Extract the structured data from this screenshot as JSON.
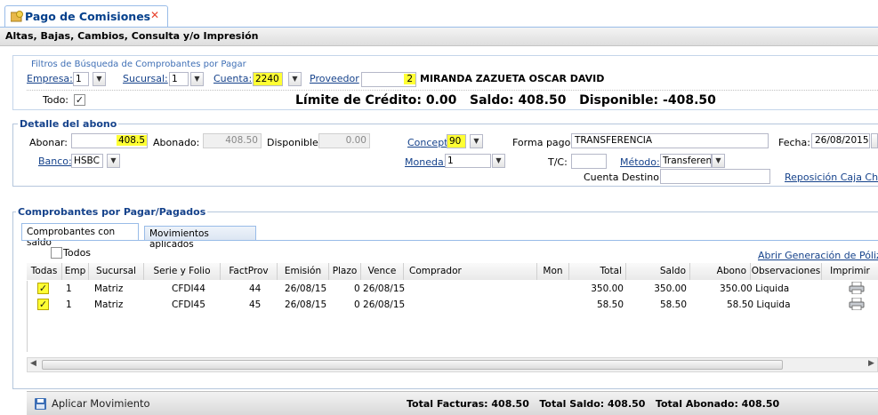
{
  "tab": {
    "label": "Pago de Comisiones",
    "close": "✕"
  },
  "title_bar": "Altas, Bajas, Cambios, Consulta y/o Impresión",
  "filters": {
    "title": "Filtros de Búsqueda de Comprobantes por Pagar",
    "empresa_label": "Empresa:",
    "empresa_value": "1",
    "sucursal_label": "Sucursal:",
    "sucursal_value": "1",
    "cuenta_label": "Cuenta:",
    "cuenta_value": "2240",
    "proveedor_label": "Proveedor",
    "proveedor_id": "2",
    "proveedor_name": "MIRANDA ZAZUETA OSCAR DAVID",
    "todo_label": "Todo:",
    "summary": "Límite de Crédito: 0.00   Saldo: 408.50   Disponible: -408.50"
  },
  "detalle": {
    "legend": "Detalle del abono",
    "abonar_label": "Abonar:",
    "abonar_value": "408.5",
    "abonado_label": "Abonado:",
    "abonado_value": "408.50",
    "disponible_label": "Disponible",
    "disponible_value": "0.00",
    "concepto_label": "Concepto:",
    "concepto_value": "90",
    "forma_pago_label": "Forma pago:",
    "forma_pago_value": "TRANSFERENCIA",
    "fecha_label": "Fecha:",
    "fecha_value": "26/08/2015",
    "banco_label": "Banco:",
    "banco_value": "HSBC",
    "moneda_label": "Moneda:",
    "moneda_value": "1",
    "tc_label": "T/C:",
    "tc_value": "",
    "metodo_label": "Método:",
    "metodo_value": "Transferen",
    "cuenta_destino_label": "Cuenta Destino:",
    "cuenta_destino_value": "",
    "reposicion_link": "Reposición Caja Chica"
  },
  "comprobantes": {
    "legend": "Comprobantes por Pagar/Pagados",
    "tabs": [
      "Comprobantes con saldo",
      "Movimientos aplicados"
    ],
    "todos_label": "Todos",
    "poliza_link": "Abrir Generación de Póliza",
    "columns": [
      "Todas",
      "Emp",
      "Sucursal",
      "Serie y Folio",
      "FactProv",
      "Emisión",
      "Plazo",
      "Vence",
      "Comprador",
      "Mon",
      "Total",
      "Saldo",
      "Abono",
      "Observaciones",
      "Imprimir"
    ],
    "rows": [
      {
        "emp": "1",
        "sucursal": "Matriz",
        "folio": "CFDI44",
        "factprov": "44",
        "emision": "26/08/15",
        "plazo_vence": "0 26/08/15",
        "total": "350.00",
        "saldo": "350.00",
        "abono_obs": "350.00 Liquida"
      },
      {
        "emp": "1",
        "sucursal": "Matriz",
        "folio": "CFDI45",
        "factprov": "45",
        "emision": "26/08/15",
        "plazo_vence": "0 26/08/15",
        "total": "58.50",
        "saldo": "58.50",
        "abono_obs": "58.50 Liquida"
      }
    ]
  },
  "footer": {
    "apply_label": "Aplicar Movimiento",
    "totals": "Total Facturas: 408.50   Total Saldo: 408.50   Total Abonado: 408.50"
  }
}
